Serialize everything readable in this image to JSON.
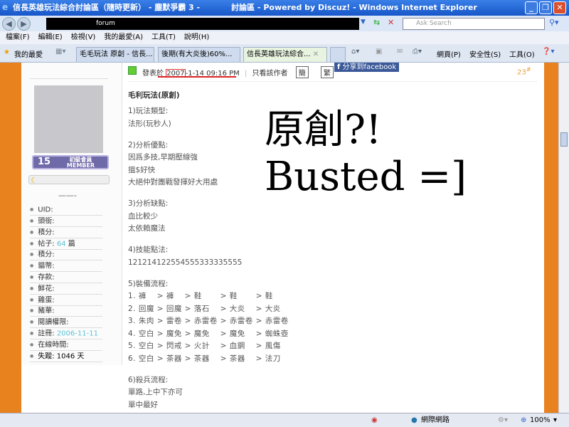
{
  "window": {
    "title": "信長英雄玩法綜合討論區（隨時更新） - 塵默爭霸 3 -　　　　討論區 - Powered by Discuz! - Windows Internet Explorer"
  },
  "address": {
    "url": "forum",
    "search_placeholder": "Ask Search"
  },
  "menu": [
    "檔案(F)",
    "編輯(E)",
    "檢視(V)",
    "我的最愛(A)",
    "工具(T)",
    "說明(H)"
  ],
  "favorites_label": "我的最愛",
  "tabs": [
    "毛毛玩法 原創 - 信長...",
    "後期(有大炎後)60%...",
    "信長英雄玩法綜合..."
  ],
  "toolbar": {
    "page": "網頁(P)",
    "safety": "安全性(S)",
    "tools": "工具(O)"
  },
  "sidebar": {
    "badge_level": "15",
    "badge_title": "初級會員",
    "badge_sub": "MEMBER",
    "dash": "——-",
    "items": [
      "UID:",
      "頭銜:",
      "積分:",
      "帖子: 64 篇",
      "積分:",
      "貓幣:",
      "存款:",
      "鮮花:",
      "雞蛋:",
      "豬華:",
      "閱讀權限:",
      "註冊: 2006-11-11",
      "在線時間:",
      "失蹤: 1046 天"
    ]
  },
  "post": {
    "posted_prefix": "發表於",
    "date_year": "2007",
    "date_rest": "-1-14 09:16 PM",
    "only_author": "只看該作者",
    "simp": "簡",
    "trad": "繁",
    "facebook": "分享到facebook",
    "floor": "23",
    "title": "毛利玩法(原創)",
    "lines": [
      "1)玩法類型:",
      "法形(玩秒人)",
      "",
      "2)分析優點:",
      "因爲多技,早期壓線強",
      "搵$好快",
      "大絕仲對團戰發揮好大用處",
      "",
      "3)分析缺點:",
      "血比較少",
      "太依賴魔法",
      "",
      "4)技能點法:",
      "121214122554555333335555",
      "",
      "5)裝備流程:",
      "1. 褲　 > 褲　 > 鞋　　 > 鞋　　 > 鞋",
      "2. 回魔 > 回魔 > 落石　 > 大炎　 > 大炎",
      "3. 朱肉 > 雷卷 > 赤雷卷 > 赤雷卷 > 赤雷卷",
      "4. 空白 > 魔免 > 魔免　 > 魔免　 > 蜘蛛壺",
      "5. 空白 > 閃戒 > 火計　 > 血鋼　 > 風傷",
      "6. 空白 > 茶器 > 茶器　 > 茶器　 > 法刀",
      "",
      "6)殺兵流程:",
      "單路,上中下亦可",
      "單中最好"
    ],
    "overlay_line1": "原創?!",
    "overlay_line2": "Busted =]"
  },
  "status": {
    "zone": "網際網路",
    "zoom": "100%"
  }
}
